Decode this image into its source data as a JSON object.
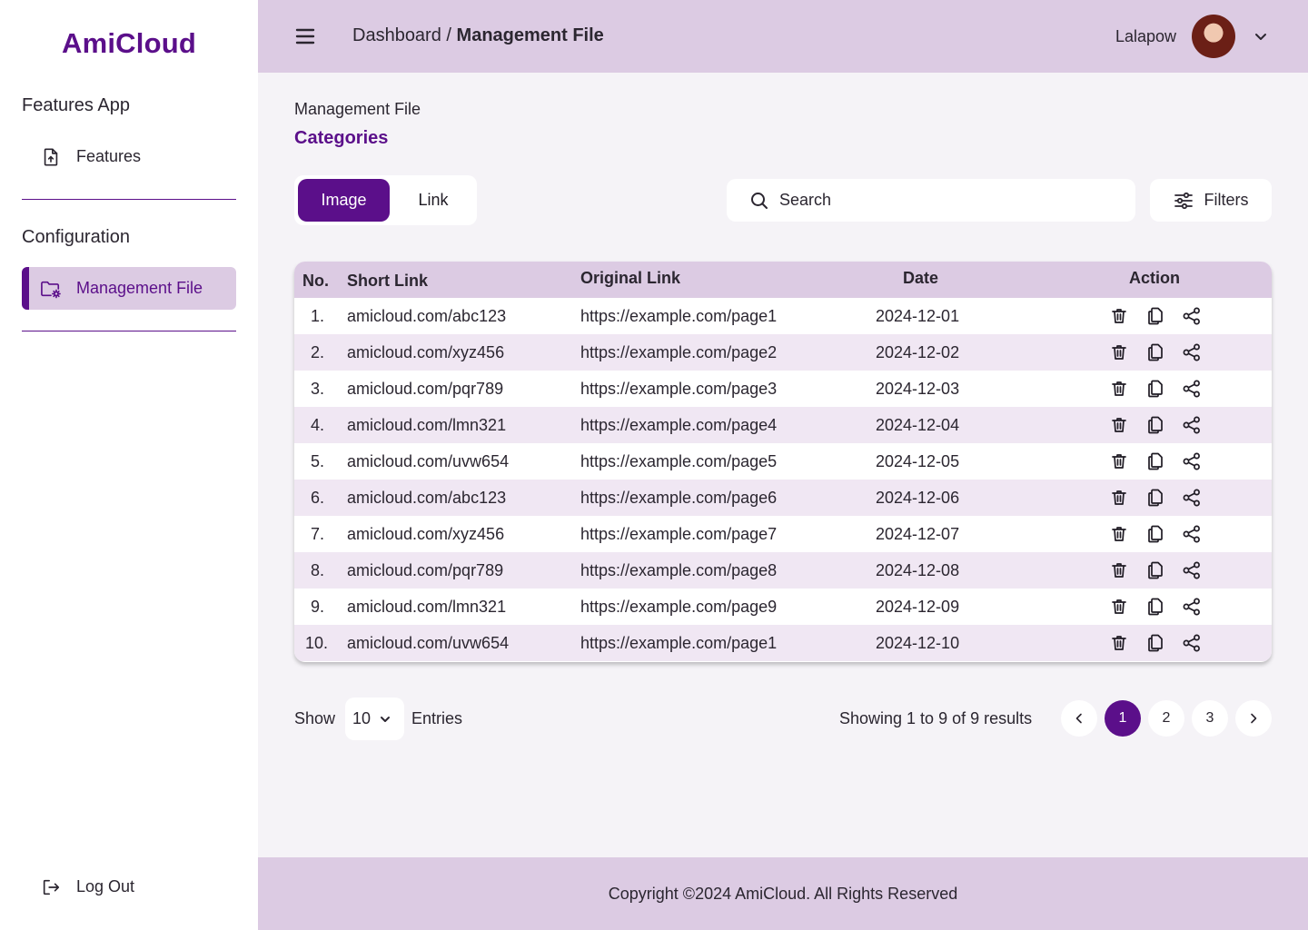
{
  "sidebar": {
    "logo": "AmiCloud",
    "section_features": "Features App",
    "section_config": "Configuration",
    "items": [
      {
        "label": "Features",
        "icon": "file-upload-icon"
      },
      {
        "label": "Management File",
        "icon": "folder-settings-icon",
        "active": true
      }
    ],
    "logout_label": "Log Out"
  },
  "header": {
    "breadcrumb_root": "Dashboard",
    "breadcrumb_sep": "/",
    "breadcrumb_current": "Management File",
    "username": "Lalapow"
  },
  "main": {
    "subtitle": "Management File",
    "title": "Categories",
    "tabs": [
      {
        "label": "Image",
        "active": true
      },
      {
        "label": "Link",
        "active": false
      }
    ],
    "search_placeholder": "Search",
    "filters_label": "Filters"
  },
  "table": {
    "columns": [
      "No.",
      "Short Link",
      "Original Link",
      "Date",
      "Action"
    ],
    "rows": [
      {
        "no": "1.",
        "short": "amicloud.com/abc123",
        "original": "https://example.com/page1",
        "date": "2024-12-01"
      },
      {
        "no": "2.",
        "short": "amicloud.com/xyz456",
        "original": "https://example.com/page2",
        "date": "2024-12-02"
      },
      {
        "no": "3.",
        "short": "amicloud.com/pqr789",
        "original": "https://example.com/page3",
        "date": "2024-12-03"
      },
      {
        "no": "4.",
        "short": "amicloud.com/lmn321",
        "original": "https://example.com/page4",
        "date": "2024-12-04"
      },
      {
        "no": "5.",
        "short": "amicloud.com/uvw654",
        "original": "https://example.com/page5",
        "date": "2024-12-05"
      },
      {
        "no": "6.",
        "short": "amicloud.com/abc123",
        "original": "https://example.com/page6",
        "date": "2024-12-06"
      },
      {
        "no": "7.",
        "short": "amicloud.com/xyz456",
        "original": "https://example.com/page7",
        "date": "2024-12-07"
      },
      {
        "no": "8.",
        "short": "amicloud.com/pqr789",
        "original": "https://example.com/page8",
        "date": "2024-12-08"
      },
      {
        "no": "9.",
        "short": "amicloud.com/lmn321",
        "original": "https://example.com/page9",
        "date": "2024-12-09"
      },
      {
        "no": "10.",
        "short": "amicloud.com/uvw654",
        "original": "https://example.com/page1",
        "date": "2024-12-10"
      }
    ],
    "actions": [
      "trash-icon",
      "copy-icon",
      "share-icon"
    ]
  },
  "pagination": {
    "show_label": "Show",
    "entries_value": "10",
    "entries_label": "Entries",
    "results_text": "Showing 1 to 9 of 9 results",
    "pages": [
      "1",
      "2",
      "3"
    ],
    "current_page": "1"
  },
  "footer": {
    "copyright": "Copyright ©2024 AmiCloud. All Rights Reserved"
  },
  "colors": {
    "accent": "#5b0f8a",
    "header_bg": "#dccbe3",
    "row_alt": "#f0e7f3",
    "page_bg": "#f5f3f7"
  }
}
